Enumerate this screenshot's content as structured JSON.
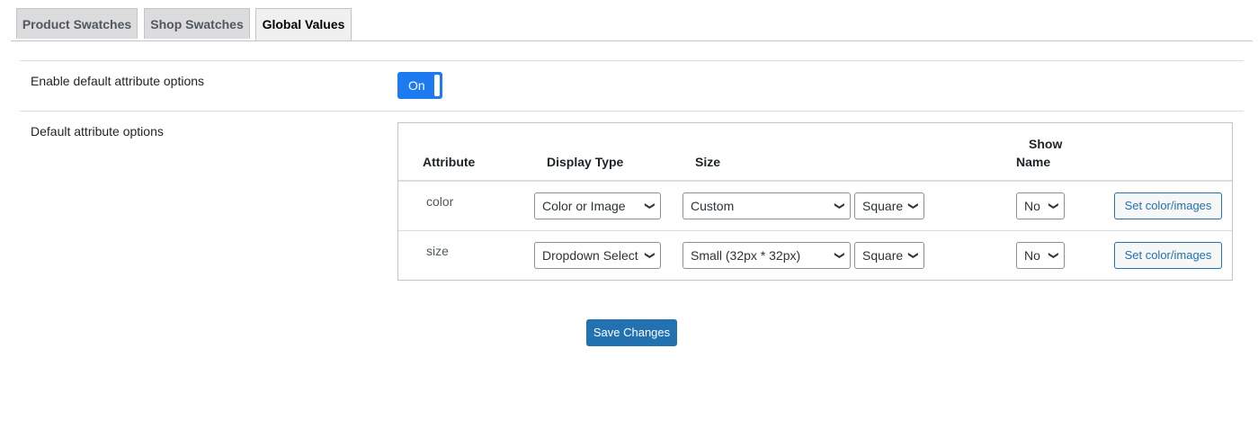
{
  "tabs": [
    {
      "label": "Product Swatches"
    },
    {
      "label": "Shop Swatches"
    },
    {
      "label": "Global Values"
    }
  ],
  "settings": {
    "enable_label": "Enable default attribute options",
    "toggle_label": "On",
    "defaults_label": "Default attribute options"
  },
  "table": {
    "headers": {
      "attribute": "Attribute",
      "display_type": "Display Type",
      "size": "Size",
      "show_name_1": "Show",
      "show_name_2": "Name"
    },
    "rows": [
      {
        "attribute": "color",
        "display_type": "Color or Image",
        "size": "Custom",
        "shape": "Square",
        "show_name": "No",
        "action": "Set color/images"
      },
      {
        "attribute": "size",
        "display_type": "Dropdown Select",
        "size": "Small (32px * 32px)",
        "shape": "Square",
        "show_name": "No",
        "action": "Set color/images"
      }
    ]
  },
  "save_label": "Save Changes",
  "colors": {
    "accent": "#2271b1",
    "toggle": "#1d7af0"
  }
}
